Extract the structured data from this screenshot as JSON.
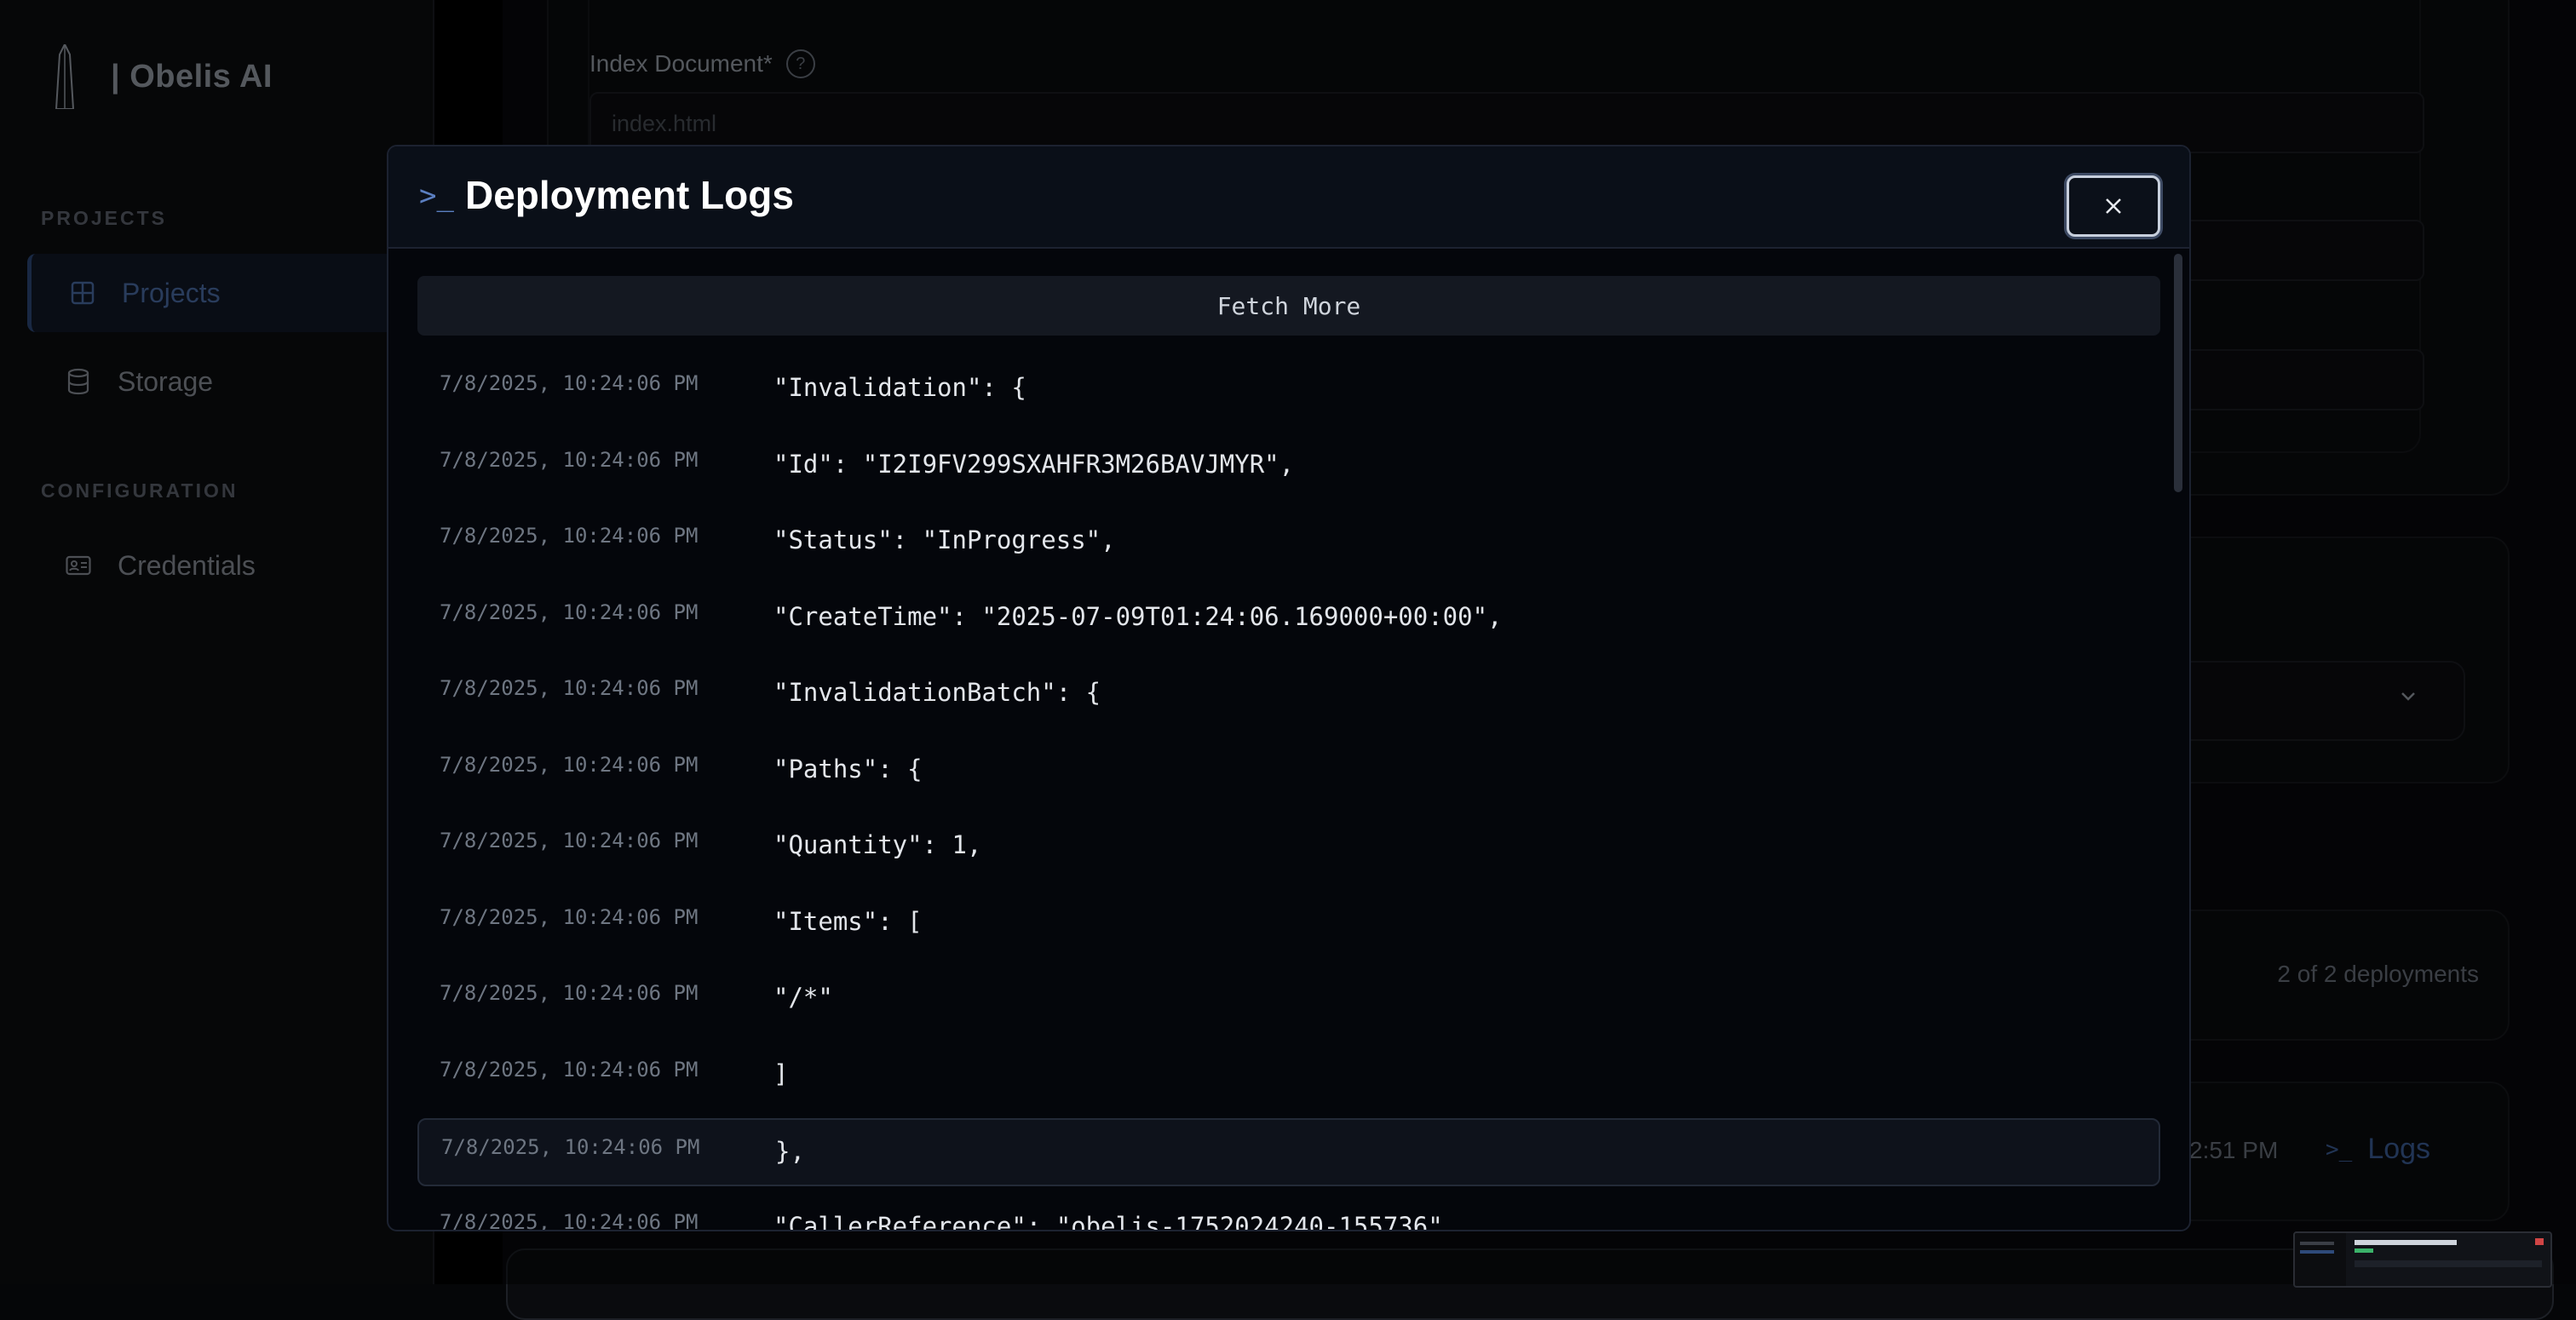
{
  "app": {
    "name": "| Obelis AI"
  },
  "sidebar": {
    "sections": [
      {
        "label": "PROJECTS"
      },
      {
        "label": "CONFIGURATION"
      }
    ],
    "items": [
      {
        "label": "Projects",
        "icon": "grid-icon",
        "active": true
      },
      {
        "label": "Storage",
        "icon": "database-icon",
        "active": false
      },
      {
        "label": "Credentials",
        "icon": "id-card-icon",
        "active": false
      }
    ]
  },
  "background": {
    "index_document_label": "Index Document*",
    "index_document_placeholder": "index.html",
    "deployments_count": "2 of 2 deployments",
    "row_time": "2:51 PM",
    "logs_link": "Logs"
  },
  "modal": {
    "title": "Deployment Logs",
    "fetch_more": "Fetch More",
    "logs": [
      {
        "timestamp": "7/8/2025, 10:24:06 PM",
        "message": "\"Invalidation\": {"
      },
      {
        "timestamp": "7/8/2025, 10:24:06 PM",
        "message": "\"Id\": \"I2I9FV299SXAHFR3M26BAVJMYR\","
      },
      {
        "timestamp": "7/8/2025, 10:24:06 PM",
        "message": "\"Status\": \"InProgress\","
      },
      {
        "timestamp": "7/8/2025, 10:24:06 PM",
        "message": "\"CreateTime\": \"2025-07-09T01:24:06.169000+00:00\","
      },
      {
        "timestamp": "7/8/2025, 10:24:06 PM",
        "message": "\"InvalidationBatch\": {"
      },
      {
        "timestamp": "7/8/2025, 10:24:06 PM",
        "message": "\"Paths\": {"
      },
      {
        "timestamp": "7/8/2025, 10:24:06 PM",
        "message": "\"Quantity\": 1,"
      },
      {
        "timestamp": "7/8/2025, 10:24:06 PM",
        "message": "\"Items\": ["
      },
      {
        "timestamp": "7/8/2025, 10:24:06 PM",
        "message": "\"/*\""
      },
      {
        "timestamp": "7/8/2025, 10:24:06 PM",
        "message": "]"
      },
      {
        "timestamp": "7/8/2025, 10:24:06 PM",
        "message": "},"
      },
      {
        "timestamp": "7/8/2025, 10:24:06 PM",
        "message": "\"CallerReference\": \"obelis-1752024240-155736\""
      }
    ],
    "highlighted_index": 10
  },
  "colors": {
    "accent": "#4b6ea8",
    "modal_bg": "#04060b",
    "sidebar_bg": "#0c0d10"
  }
}
